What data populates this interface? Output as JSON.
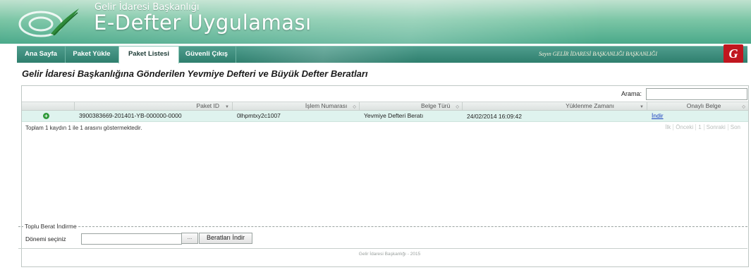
{
  "header": {
    "org_name": "Gelir İdaresi Başkanlığı",
    "app_title": "E-Defter Uygulaması",
    "logo_icon": "gib-logo-icon"
  },
  "nav": {
    "tabs": [
      {
        "label": "Ana Sayfa",
        "active": false
      },
      {
        "label": "Paket Yükle",
        "active": false
      },
      {
        "label": "Paket Listesi",
        "active": true
      },
      {
        "label": "Güvenli Çıkış",
        "active": false
      }
    ],
    "user_text": "Sayın GELİR İDARESİ BAŞKANLIĞI BAŞKANLIĞI",
    "badge_text": "G"
  },
  "page_title": "Gelir İdaresi Başkanlığına Gönderilen Yevmiye Defteri ve Büyük Defter Beratları",
  "search": {
    "label": "Arama:",
    "value": ""
  },
  "table": {
    "columns": [
      {
        "label": "",
        "sort": ""
      },
      {
        "label": "Paket ID",
        "sort": "▼"
      },
      {
        "label": "İşlem Numarası",
        "sort": "◇"
      },
      {
        "label": "Belge Türü",
        "sort": "◇"
      },
      {
        "label": "Yüklenme Zamanı",
        "sort": "▼"
      },
      {
        "label": "Onaylı Belge",
        "sort": "◇"
      }
    ],
    "rows": [
      {
        "paket_id": "3900383669-201401-YB-000000-0000",
        "islem_numarasi": "0lhpmtxy2c1007",
        "belge_turu": "Yevmiye Defteri Beratı",
        "yuklenme_zamani": "24/02/2014 16:09:42",
        "onayli_belge": "İndir"
      }
    ],
    "info": "Toplam 1 kaydın 1 ile 1 arasını göstermektedir.",
    "pager": {
      "first": "İlk",
      "prev": "Önceki",
      "page": "1",
      "next": "Sonraki",
      "last": "Son"
    }
  },
  "bulk": {
    "legend": "Toplu Berat İndirme",
    "period_label": "Dönemi seçiniz",
    "period_value": "",
    "browse_label": "...",
    "download_label": "Beratları İndir"
  },
  "footer": "Gelir İdaresi Başkanlığı - 2015",
  "colors": {
    "header_green": "#4aa98a",
    "nav_green": "#2f7f6e",
    "row_highlight": "#dff3ee",
    "badge_red": "#c0161f"
  }
}
